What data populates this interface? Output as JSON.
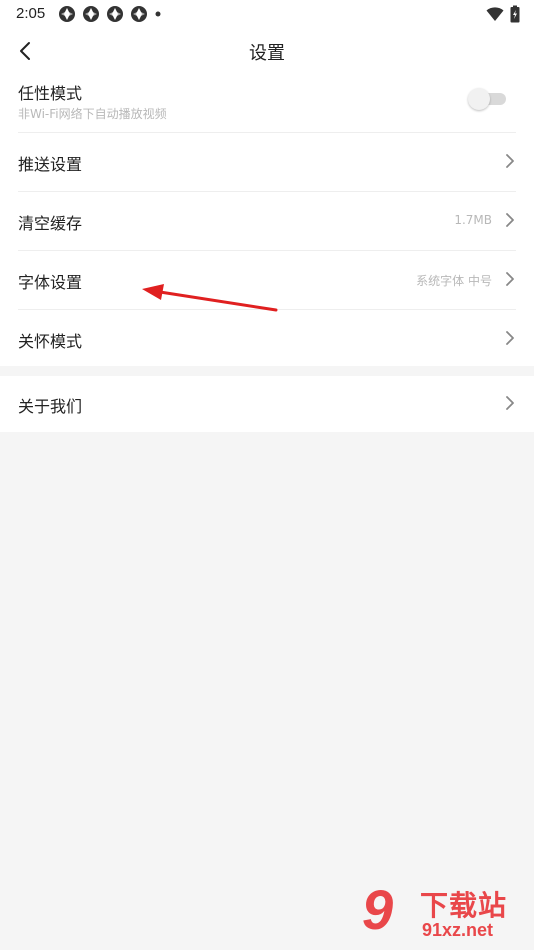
{
  "status_bar": {
    "time": "2:05",
    "left_icons": [
      "app-notification-icon",
      "app-notification-icon",
      "app-notification-icon",
      "app-notification-icon",
      "more-dot-icon"
    ],
    "right_icons": [
      "wifi-icon",
      "battery-icon"
    ]
  },
  "header": {
    "title": "设置",
    "back_icon": "back-arrow-icon"
  },
  "settings": {
    "group1": [
      {
        "label": "任性模式",
        "sublabel": "非Wi-Fi网络下自动播放视频",
        "control": "toggle",
        "toggle_on": false
      },
      {
        "label": "推送设置",
        "control": "chevron"
      },
      {
        "label": "清空缓存",
        "value": "1.7MB",
        "control": "chevron"
      },
      {
        "label": "字体设置",
        "value": "系统字体 中号",
        "control": "chevron"
      },
      {
        "label": "关怀模式",
        "control": "chevron"
      }
    ],
    "group2": [
      {
        "label": "关于我们",
        "control": "chevron"
      }
    ]
  },
  "watermark": {
    "logo_number": "9",
    "title": "下载站",
    "domain": "91xz.net"
  },
  "colors": {
    "background": "#f5f5f5",
    "card": "#ffffff",
    "text": "#222222",
    "muted": "#b8b8b8",
    "annotation": "#e02020",
    "watermark": "#e9474a"
  }
}
